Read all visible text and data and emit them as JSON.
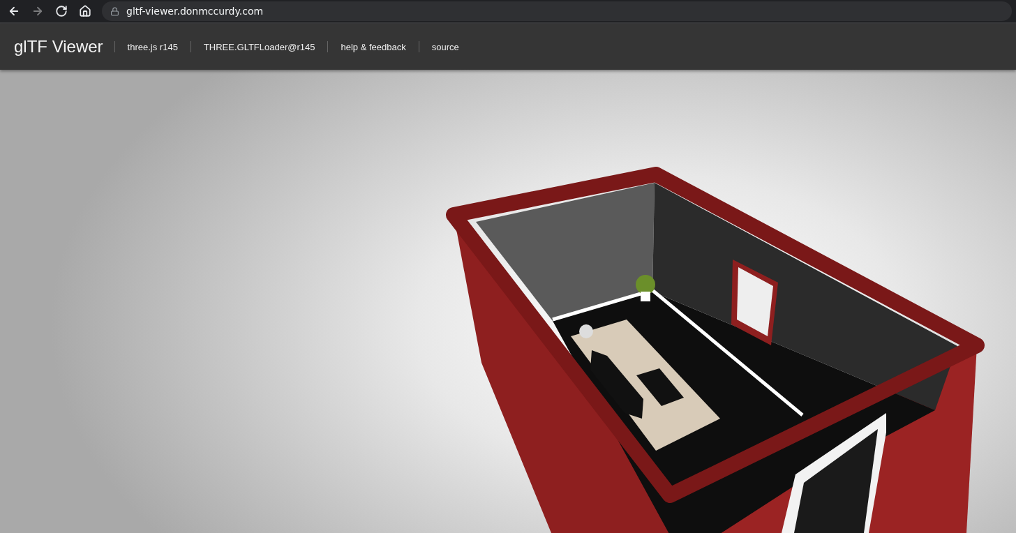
{
  "browser": {
    "nav": [
      {
        "kind": "back",
        "disabled": false
      },
      {
        "kind": "forward",
        "disabled": true
      },
      {
        "kind": "reload",
        "disabled": false
      },
      {
        "kind": "home",
        "disabled": false
      }
    ],
    "address": "gltf-viewer.donmccurdy.com"
  },
  "header": {
    "title": "glTF Viewer",
    "links": [
      "three.js r145",
      "THREE.GLTFLoader@r145",
      "help & feedback",
      "source"
    ]
  }
}
